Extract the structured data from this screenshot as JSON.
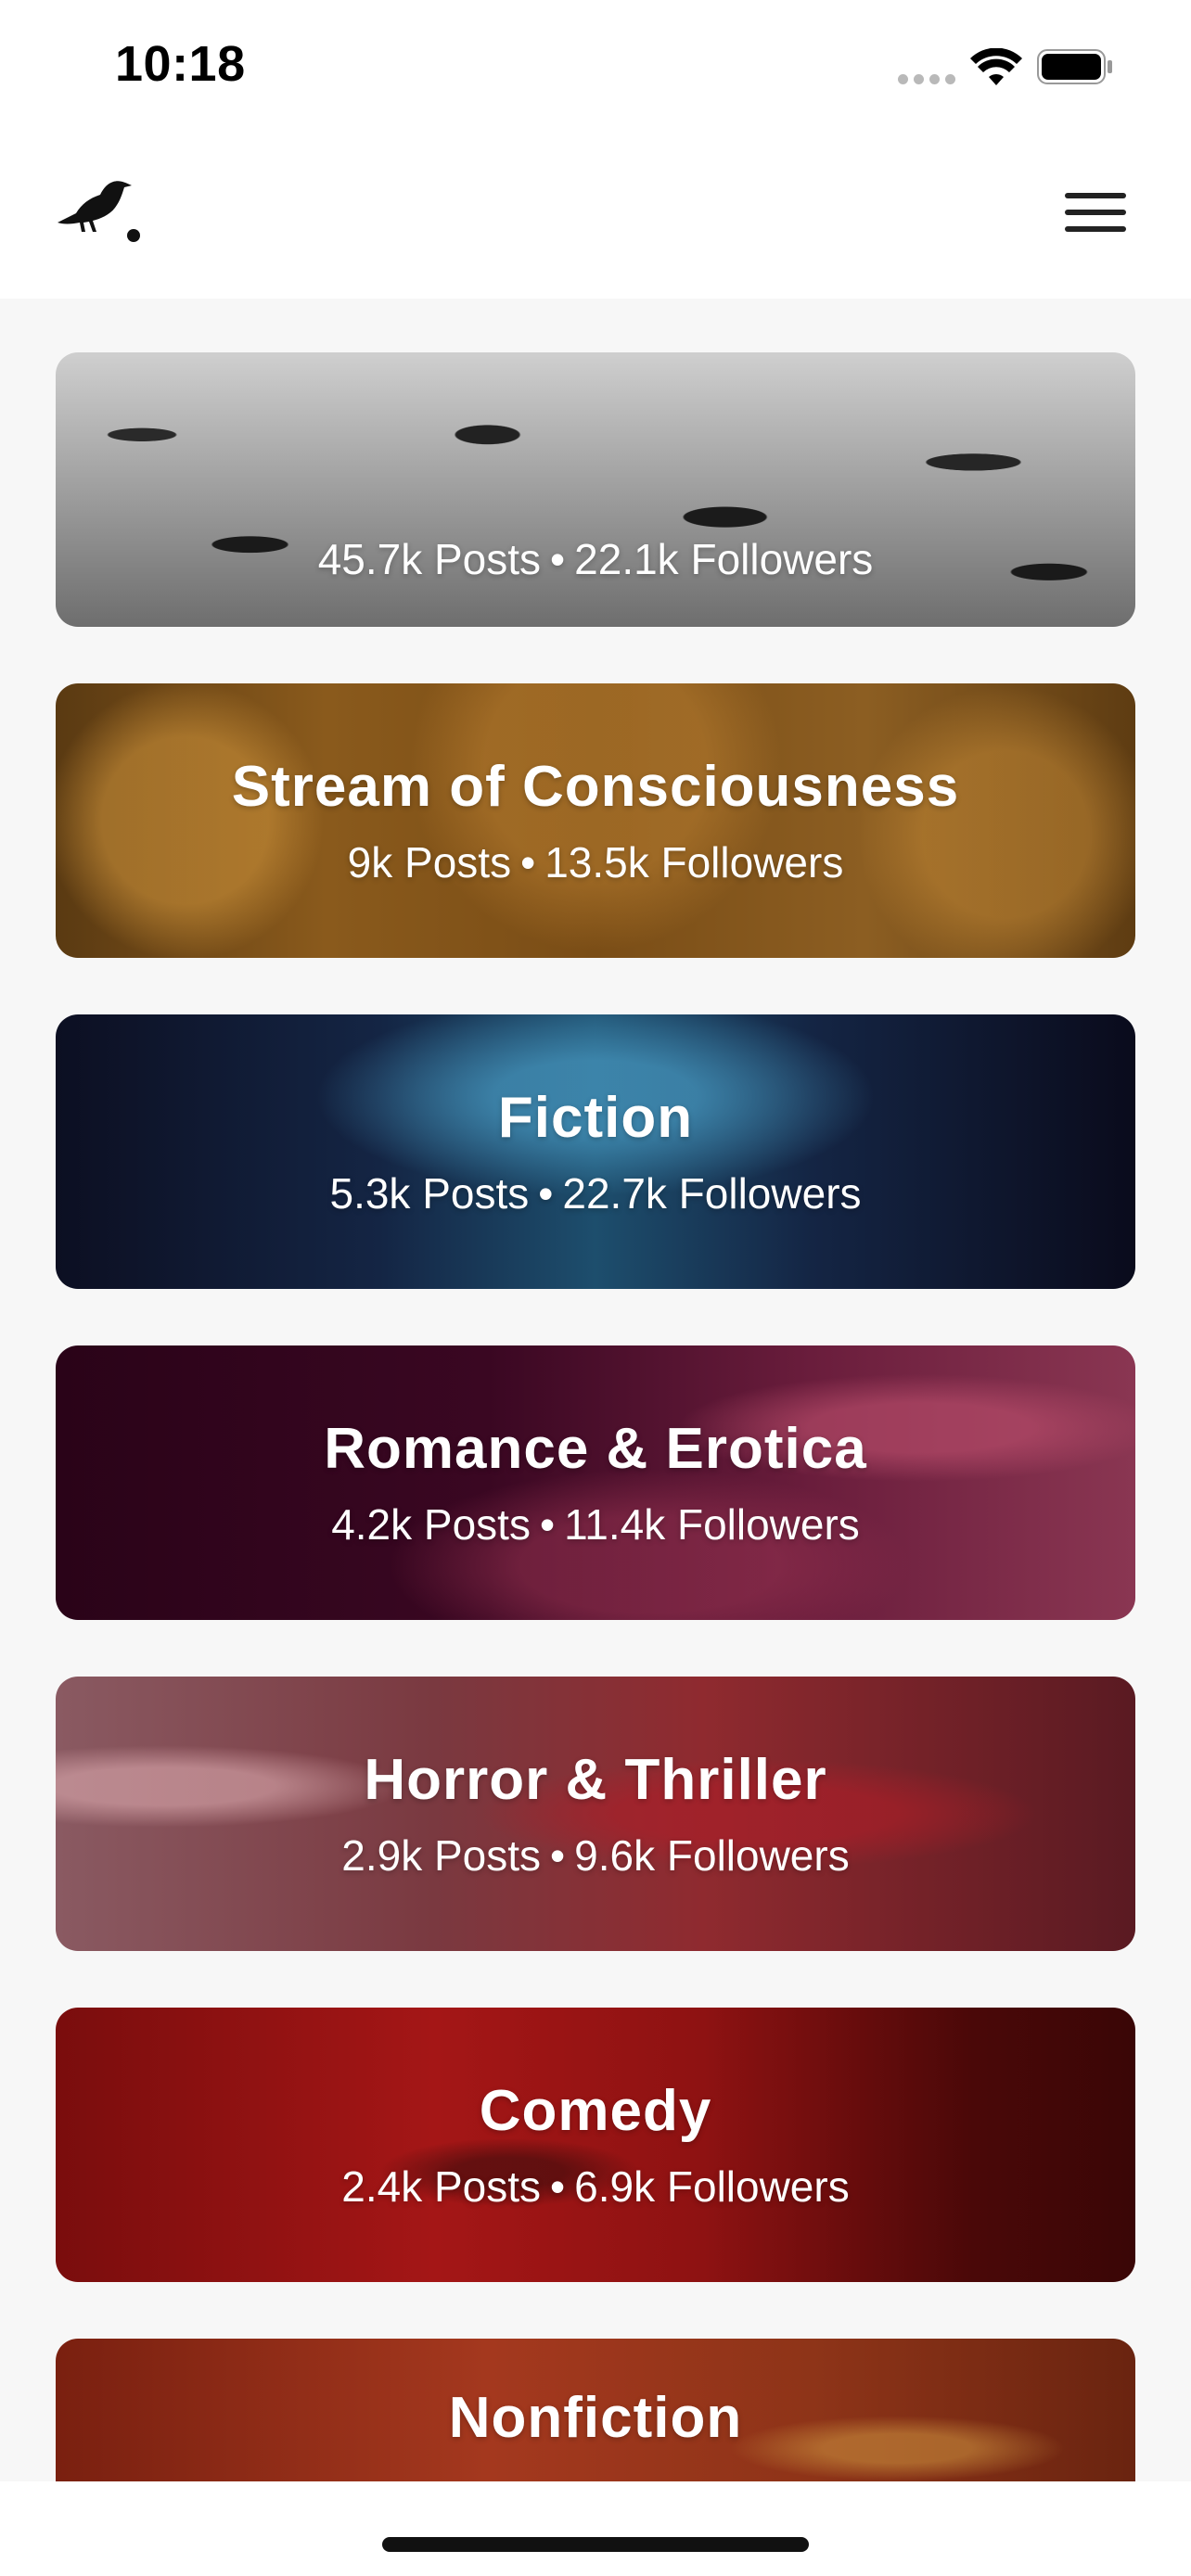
{
  "status_bar": {
    "time": "10:18"
  },
  "header": {
    "logo_icon": "raven-logo-icon",
    "menu_icon": "hamburger-menu-icon"
  },
  "categories": [
    {
      "title": "",
      "stats": {
        "posts": "45.7k Posts",
        "separator": "•",
        "followers": "22.1k Followers"
      }
    },
    {
      "title": "Stream of Consciousness",
      "stats": {
        "posts": "9k Posts",
        "separator": "•",
        "followers": "13.5k Followers"
      }
    },
    {
      "title": "Fiction",
      "stats": {
        "posts": "5.3k Posts",
        "separator": "•",
        "followers": "22.7k Followers"
      }
    },
    {
      "title": "Romance & Erotica",
      "stats": {
        "posts": "4.2k Posts",
        "separator": "•",
        "followers": "11.4k Followers"
      }
    },
    {
      "title": "Horror & Thriller",
      "stats": {
        "posts": "2.9k Posts",
        "separator": "•",
        "followers": "9.6k Followers"
      }
    },
    {
      "title": "Comedy",
      "stats": {
        "posts": "2.4k Posts",
        "separator": "•",
        "followers": "6.9k Followers"
      }
    },
    {
      "title": "Nonfiction"
    }
  ]
}
